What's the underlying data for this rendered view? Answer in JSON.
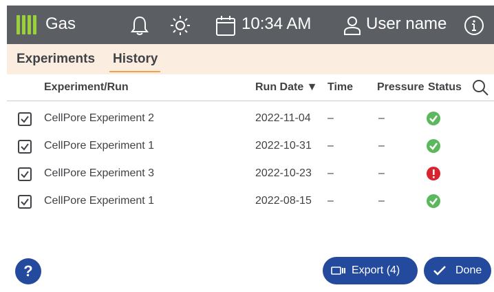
{
  "header": {
    "app_title": "Gas",
    "time": "10:34 AM",
    "user": "User name",
    "accent": "#9ad13b",
    "bg": "#5b5e62"
  },
  "tabs": [
    {
      "label": "Experiments",
      "active": false
    },
    {
      "label": "History",
      "active": true
    }
  ],
  "table": {
    "columns": [
      "Experiment/Run",
      "Run Date ▼",
      "Time",
      "Pressure",
      "Status"
    ],
    "rows": [
      {
        "checked": true,
        "name": "CellPore Experiment 2",
        "run_date": "2022-11-04",
        "time": "–",
        "pressure": "–",
        "status": "success"
      },
      {
        "checked": true,
        "name": "CellPore Experiment 1",
        "run_date": "2022-10-31",
        "time": "–",
        "pressure": "–",
        "status": "success"
      },
      {
        "checked": true,
        "name": "CellPore Experiment 3",
        "run_date": "2022-10-23",
        "time": "–",
        "pressure": "–",
        "status": "error"
      },
      {
        "checked": true,
        "name": "CellPore Experiment 1",
        "run_date": "2022-08-15",
        "time": "–",
        "pressure": "–",
        "status": "success"
      }
    ]
  },
  "footer": {
    "help_label": "?",
    "export_label": "Export (4)",
    "done_label": "Done"
  },
  "icons": {
    "app": "gas-bars-icon",
    "bell": "bell-icon",
    "brightness": "brightness-icon",
    "calendar": "calendar-icon",
    "user": "user-icon",
    "info": "info-icon",
    "search": "search-icon",
    "export": "export-icon",
    "done": "check-icon"
  },
  "colors": {
    "success": "#5cb85c",
    "error": "#d9232e",
    "primary": "#244a9d",
    "tab_bg": "#fbeee1",
    "tab_underline": "#f0a24d"
  }
}
